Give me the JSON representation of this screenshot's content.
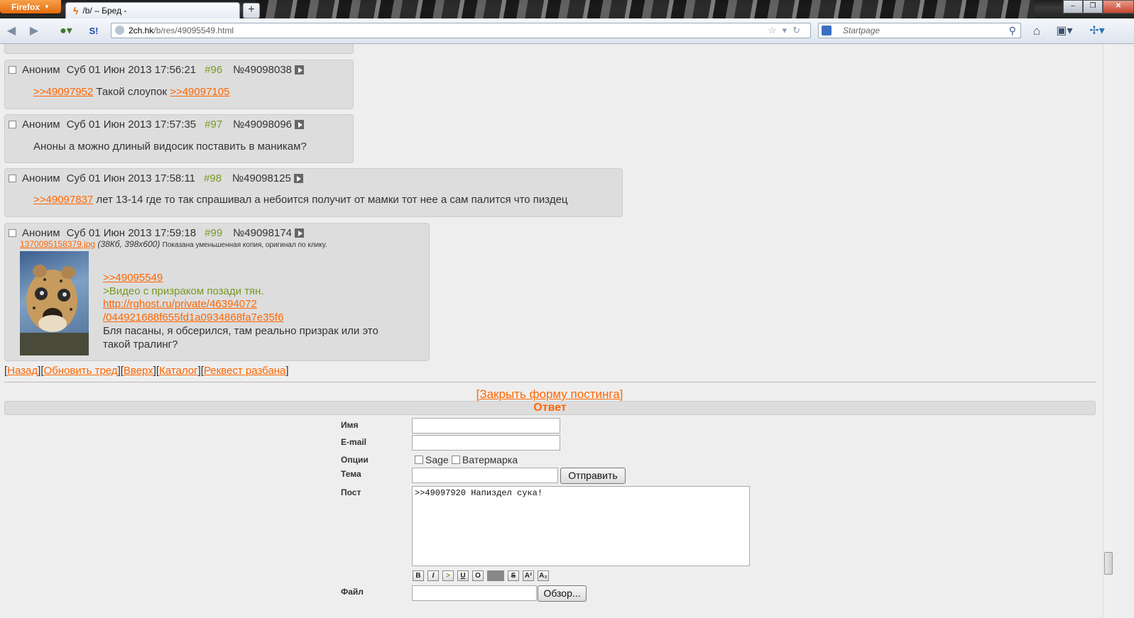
{
  "browser": {
    "app_button": "Firefox",
    "tab_title": "/b/ – Бред -",
    "url_host": "2ch.hk",
    "url_path": "/b/res/49095549.html",
    "search_placeholder": "Startpage"
  },
  "posts": [
    {
      "author": "Аноним",
      "date": "Суб 01 Июн 2013 17:56:21",
      "num": "#96",
      "id": "№49098038",
      "ref1": ">>49097952",
      "text": " Такой слоупок ",
      "ref2": ">>49097105"
    },
    {
      "author": "Аноним",
      "date": "Суб 01 Июн 2013 17:57:35",
      "num": "#97",
      "id": "№49098096",
      "text": "Аноны а можно длиный видосик поставить в маникам?"
    },
    {
      "author": "Аноним",
      "date": "Суб 01 Июн 2013 17:58:11",
      "num": "#98",
      "id": "№49098125",
      "ref1": ">>49097837",
      "text": " лет 13-14 где то так спрашивал а небоится получит от мамки тот нее а сам палится что пиздец"
    },
    {
      "author": "Аноним",
      "date": "Суб 01 Июн 2013 17:59:18",
      "num": "#99",
      "id": "№49098174",
      "file_name": "1370095158379.jpg",
      "file_meta": "(38Кб, 398x600)",
      "file_note": "Показана уменьшенная копия, оригинал по клику.",
      "ref1": ">>49095549",
      "quote": ">Видео с призраком позади тян.",
      "link1": "http://rghost.ru/private/46394072",
      "link2": "/044921688f655fd1a0934868fa7e35f6",
      "line1": "Бля пасаны, я обсерился, там реально призрак или это",
      "line2": "такой тралинг?"
    }
  ],
  "nav_links": [
    "Назад",
    "Обновить тред",
    "Вверх",
    "Каталог",
    "Реквест разбана"
  ],
  "form": {
    "close_link": "[Закрыть форму постинга]",
    "reply_title": "Ответ",
    "name_label": "Имя",
    "email_label": "E-mail",
    "options_label": "Опции",
    "sage_label": "Sage",
    "watermark_label": "Ватермарка",
    "subject_label": "Тема",
    "submit_label": "Отправить",
    "post_label": "Пост",
    "post_value": ">>49097920 Напиздел сука!",
    "file_label": "Файл",
    "browse_label": "Обзор..."
  },
  "colors": {
    "link": "#ff6600",
    "greentext": "#789922",
    "post_bg": "#dddddd",
    "page_bg": "#eeeeee"
  }
}
